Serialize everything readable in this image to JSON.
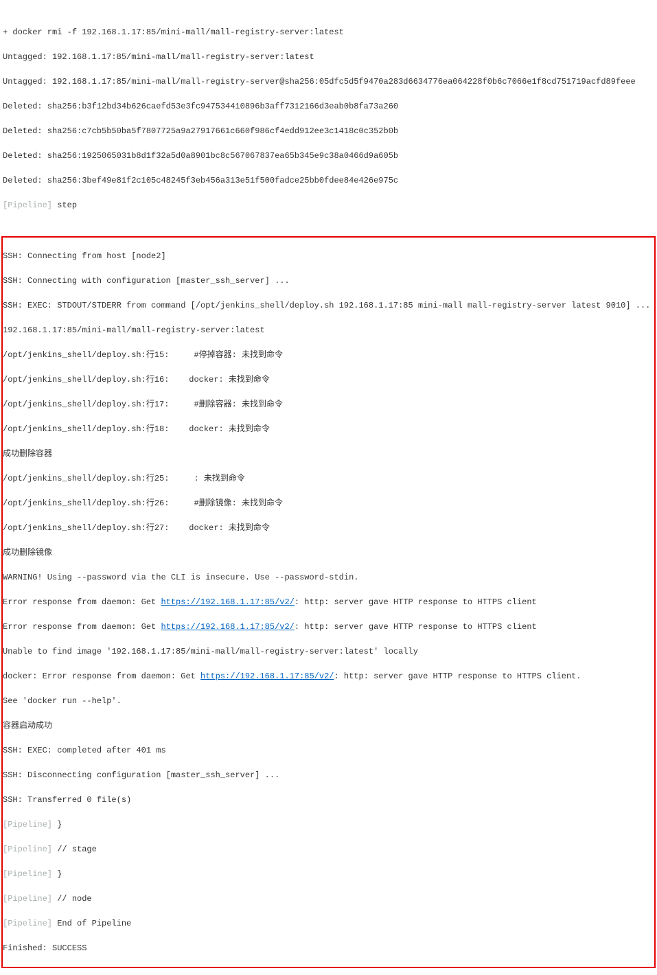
{
  "top": {
    "l1": "+ docker rmi -f 192.168.1.17:85/mini-mall/mall-registry-server:latest",
    "l2": "Untagged: 192.168.1.17:85/mini-mall/mall-registry-server:latest",
    "l3": "Untagged: 192.168.1.17:85/mini-mall/mall-registry-server@sha256:05dfc5d5f9470a283d6634776ea064228f0b6c7066e1f8cd751719acfd89feee",
    "l4": "Deleted: sha256:b3f12bd34b626caefd53e3fc947534410896b3aff7312166d3eab0b8fa73a260",
    "l5": "Deleted: sha256:c7cb5b50ba5f7807725a9a27917661c660f986cf4edd912ee3c1418c0c352b0b",
    "l6": "Deleted: sha256:1925065031b8d1f32a5d0a8901bc8c567067837ea65b345e9c38a0466d9a605b",
    "l7": "Deleted: sha256:3bef49e81f2c105c48245f3eb456a313e51f500fadce25bb0fdee84e426e975c",
    "l8a": "[Pipeline]",
    "l8b": " step"
  },
  "box": {
    "l1": "SSH: Connecting from host [node2]",
    "l2": "SSH: Connecting with configuration [master_ssh_server] ...",
    "l3": "SSH: EXEC: STDOUT/STDERR from command [/opt/jenkins_shell/deploy.sh 192.168.1.17:85 mini-mall mall-registry-server latest 9010] ...",
    "l4": "192.168.1.17:85/mini-mall/mall-registry-server:latest",
    "l5": "/opt/jenkins_shell/deploy.sh:行15:     #停掉容器: 未找到命令",
    "l6": "/opt/jenkins_shell/deploy.sh:行16:    docker: 未找到命令",
    "l7": "/opt/jenkins_shell/deploy.sh:行17:     #删除容器: 未找到命令",
    "l8": "/opt/jenkins_shell/deploy.sh:行18:    docker: 未找到命令",
    "l9": "成功删除容器",
    "l10": "/opt/jenkins_shell/deploy.sh:行25:     : 未找到命令",
    "l11": "/opt/jenkins_shell/deploy.sh:行26:     #删除镜像: 未找到命令",
    "l12": "/opt/jenkins_shell/deploy.sh:行27:    docker: 未找到命令",
    "l13": "成功删除镜像",
    "l14": "WARNING! Using --password via the CLI is insecure. Use --password-stdin.",
    "l15a": "Error response from daemon: Get ",
    "l15b": "https://192.168.1.17:85/v2/",
    "l15c": ": http: server gave HTTP response to HTTPS client",
    "l16a": "Error response from daemon: Get ",
    "l16b": "https://192.168.1.17:85/v2/",
    "l16c": ": http: server gave HTTP response to HTTPS client",
    "l17": "Unable to find image '192.168.1.17:85/mini-mall/mall-registry-server:latest' locally",
    "l18a": "docker: Error response from daemon: Get ",
    "l18b": "https://192.168.1.17:85/v2/",
    "l18c": ": http: server gave HTTP response to HTTPS client.",
    "l19": "See 'docker run --help'.",
    "l20": "容器启动成功",
    "l21": "SSH: EXEC: completed after 401 ms",
    "l22": "SSH: Disconnecting configuration [master_ssh_server] ...",
    "l23": "SSH: Transferred 0 file(s)",
    "l24a": "[Pipeline]",
    "l24b": " }",
    "l25a": "[Pipeline]",
    "l25b": " // stage",
    "l26a": "[Pipeline]",
    "l26b": " }",
    "l27a": "[Pipeline]",
    "l27b": " // node",
    "l28a": "[Pipeline]",
    "l28b": " End of Pipeline",
    "l29": "Finished: SUCCESS"
  }
}
